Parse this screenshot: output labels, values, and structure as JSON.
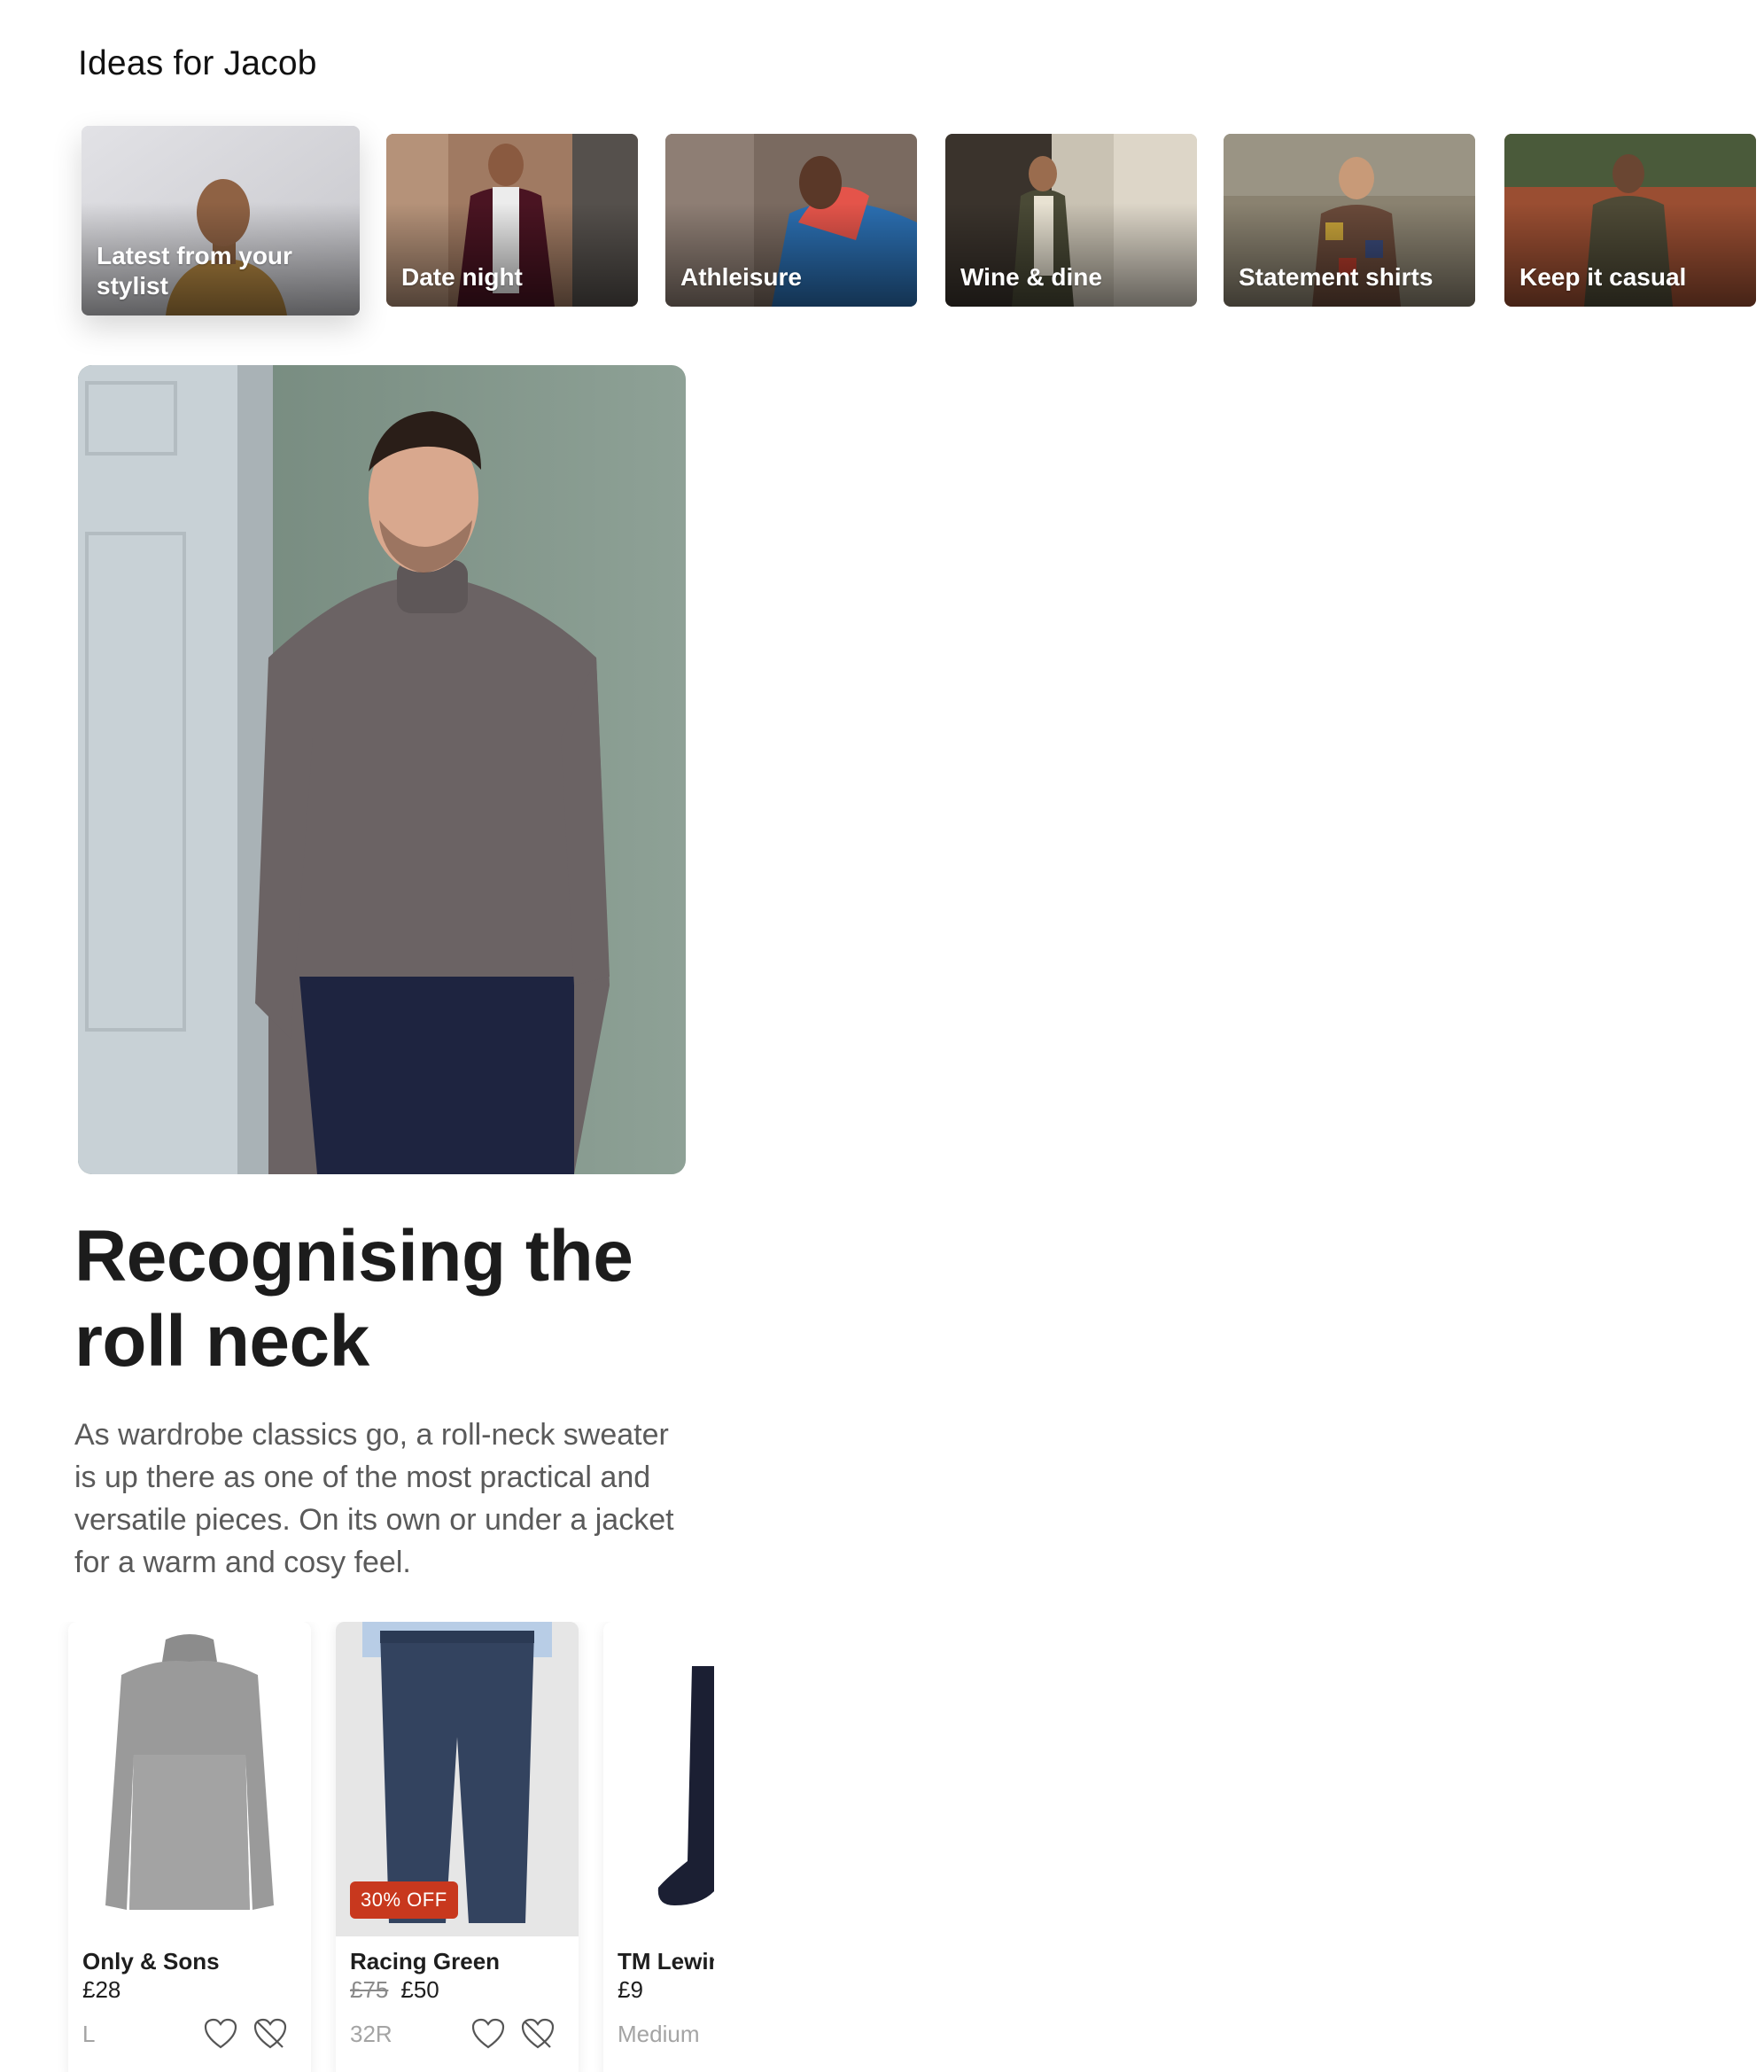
{
  "section": {
    "title": "Ideas for Jacob"
  },
  "ideas": [
    {
      "label": "Latest from your stylist"
    },
    {
      "label": "Date night"
    },
    {
      "label": "Athleisure"
    },
    {
      "label": "Wine & dine"
    },
    {
      "label": "Statement shirts"
    },
    {
      "label": "Keep it casual"
    }
  ],
  "article": {
    "title": "Recognising the roll neck",
    "body": "As wardrobe classics go, a roll-neck sweater is up there as one of the most practical and versatile pieces. On its own or under a jacket for a warm and cosy feel."
  },
  "products": [
    {
      "brand": "Only & Sons",
      "price": "£28",
      "was_price": "",
      "size": "L",
      "badge": ""
    },
    {
      "brand": "Racing Green",
      "price": "£50",
      "was_price": "£75",
      "size": "32R",
      "badge": "30% OFF"
    },
    {
      "brand": "TM Lewin",
      "price": "£9",
      "was_price": "",
      "size": "Medium",
      "badge": ""
    }
  ],
  "icons": {
    "like": "heart-icon",
    "dislike": "broken-heart-icon"
  },
  "colors": {
    "badge": "#c8381e",
    "text": "#1f1f1f",
    "muted": "#a4a4a4"
  }
}
